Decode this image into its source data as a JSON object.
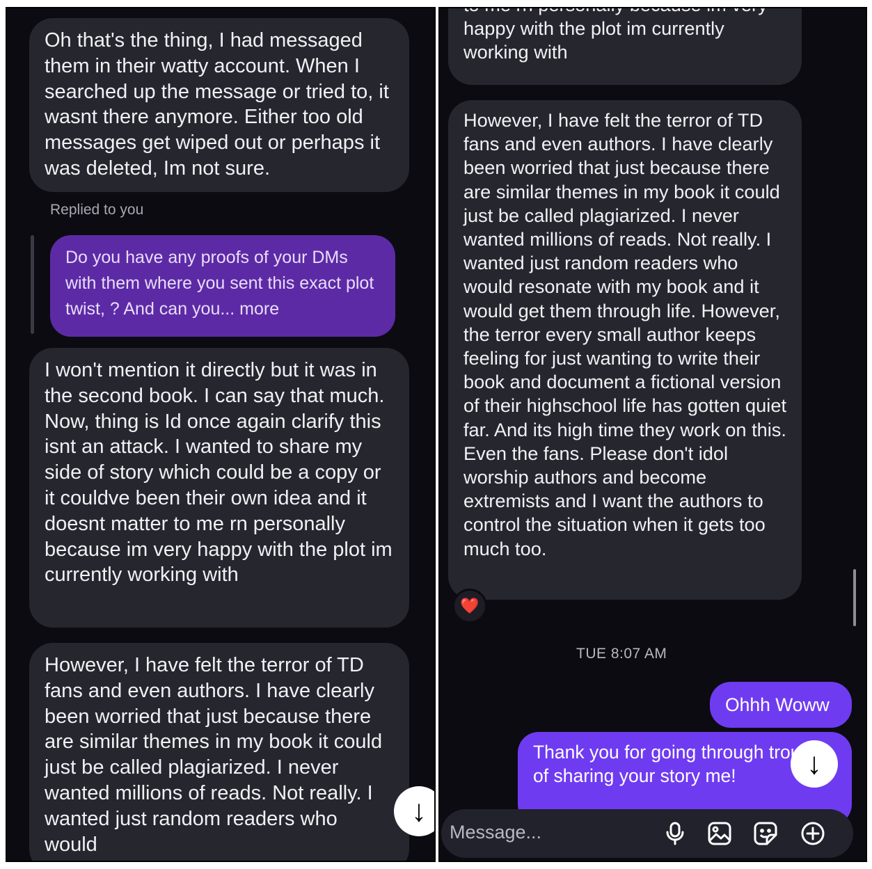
{
  "left": {
    "messages": [
      "Oh that's the thing, I had messaged them in their watty account. When I searched up the message or tried to, it wasnt there anymore. Either too old messages get wiped out or perhaps it was deleted, Im not sure.",
      "I won't mention it directly but it was in the second book. I can say that much. Now, thing is Id once again clarify this isnt an attack. I wanted to share my side of story which could be a copy or it couldve been their own idea and it doesnt matter to me rn personally because im very happy with the plot im currently working with",
      "However, I have felt the terror of TD fans and even authors. I have clearly been worried that just because there are similar themes in my book it could just be called plagiarized. I never wanted millions of reads. Not really. I wanted just random readers who would"
    ],
    "reply_label": "Replied to you",
    "reply_quote": "Do you have any proofs of your DMs with them where you sent this exact plot twist, ? And can you... more",
    "scroll_icon": "↓"
  },
  "right": {
    "top_partial": "to me rn personally because im very happy with the plot im currently working with",
    "long_message": "However, I have felt the terror of TD fans and even authors. I have clearly been worried that just because there are similar themes in my book it could just be called plagiarized. I never wanted millions of reads. Not really. I wanted just random readers who would resonate with my book and it would get them through life. However, the terror every small author keeps feeling for just wanting to write their book and document a fictional version of their highschool life has gotten quiet far. And its high time they work on this. Even the fans. Please don't idol worship authors and become extremists and I want the authors to control the situation when it gets too much too.",
    "reaction": "❤️",
    "timestamp": "TUE 8:07 AM",
    "sent_1": "Ohhh Woww",
    "sent_2": "Thank you for going through trouble of sharing your story me!",
    "scroll_icon": "↓",
    "composer_placeholder": "Message...",
    "composer_icons": [
      "microphone-icon",
      "gallery-icon",
      "sticker-icon",
      "plus-icon"
    ]
  },
  "colors": {
    "background": "#0c0b12",
    "received_bubble": "#26262f",
    "reply_quote": "#5d2aa6",
    "sent_bubble": "#6f3bf1",
    "composer": "#22222c"
  }
}
